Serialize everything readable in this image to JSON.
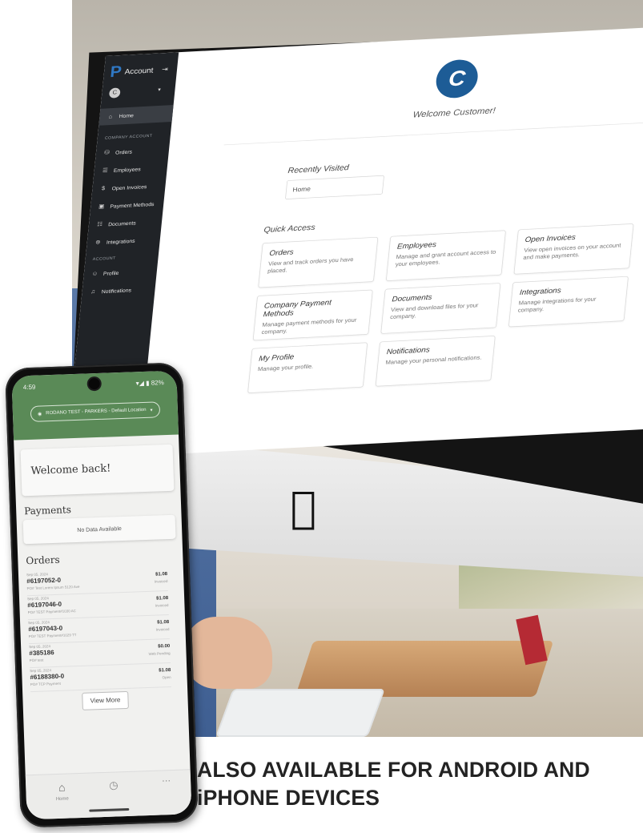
{
  "sidebar": {
    "brand_letter": "P",
    "title": "Account",
    "logout_icon": "logout-icon",
    "avatar_letter": "C",
    "home": "Home",
    "section_company": "COMPANY ACCOUNT",
    "items": [
      "Orders",
      "Employees",
      "Open Invoices",
      "Payment Methods",
      "Documents",
      "Integrations"
    ],
    "section_user": "ACCOUNT",
    "user_items": [
      "Profile",
      "Notifications"
    ]
  },
  "main": {
    "avatar_letter": "C",
    "welcome": "Welcome Customer!",
    "recently_visited_heading": "Recently Visited",
    "recently_visited_item": "Home",
    "quick_access_heading": "Quick Access",
    "cards": [
      {
        "title": "Orders",
        "desc": "View and track orders you have placed."
      },
      {
        "title": "Employees",
        "desc": "Manage and grant account access to your employees."
      },
      {
        "title": "Open Invoices",
        "desc": "View open invoices on your account and make payments."
      },
      {
        "title": "Company Payment Methods",
        "desc": "Manage payment methods for your company."
      },
      {
        "title": "Documents",
        "desc": "View and download files for your company."
      },
      {
        "title": "Integrations",
        "desc": "Manage integrations for your company."
      },
      {
        "title": "My Profile",
        "desc": "Manage your profile."
      },
      {
        "title": "Notifications",
        "desc": "Manage your personal notifications."
      }
    ]
  },
  "phone": {
    "status_time": "4:59",
    "status_right": "▾◢ ▮ 82%",
    "location": "RODANO TEST - PARKERS - Default Location",
    "welcome": "Welcome back!",
    "payments_heading": "Payments",
    "payments_empty": "No Data Available",
    "orders_heading": "Orders",
    "orders": [
      {
        "date": "Sep 05, 2024",
        "number": "#6197052-0",
        "sub": "PO# Test Lorem Ipsum 5120 Ave",
        "amount": "$1.08",
        "status": "Invoiced"
      },
      {
        "date": "Sep 05, 2024",
        "number": "#6197046-0",
        "sub": "PO# TEST Payment#1030 AC",
        "amount": "$1.08",
        "status": "Invoiced"
      },
      {
        "date": "Sep 05, 2024",
        "number": "#6197043-0",
        "sub": "PO# TEST Payment#1029 TT",
        "amount": "$1.08",
        "status": "Invoiced"
      },
      {
        "date": "Sep 05, 2024",
        "number": "#385186",
        "sub": "PO# test",
        "amount": "$0.00",
        "status": "Web Pending"
      },
      {
        "date": "Sep 05, 2024",
        "number": "#6188380-0",
        "sub": "PO# TCP Payment",
        "amount": "$1.08",
        "status": "Open"
      }
    ],
    "view_more": "View More",
    "nav_home": "Home"
  },
  "caption": {
    "line1": "ALSO AVAILABLE FOR ANDROID AND",
    "line2": "iPHONE DEVICES"
  },
  "colors": {
    "brand_blue": "#1d5c96",
    "sidebar_bg": "#202327",
    "phone_green": "#5a8a57",
    "caption_text": "#232323"
  }
}
